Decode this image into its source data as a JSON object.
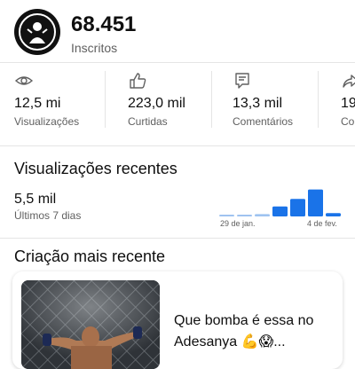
{
  "header": {
    "subscriber_count": "68.451",
    "subscriber_label": "Inscritos"
  },
  "stats": [
    {
      "icon": "eye-icon",
      "value": "12,5 mi",
      "label": "Visualizações"
    },
    {
      "icon": "thumbs-up-icon",
      "value": "223,0 mil",
      "label": "Curtidas"
    },
    {
      "icon": "comment-icon",
      "value": "13,3 mil",
      "label": "Comentários"
    },
    {
      "icon": "share-icon",
      "value": "19",
      "label": "Co"
    }
  ],
  "recent_views": {
    "title": "Visualizações recentes",
    "value": "5,5 mil",
    "period": "Últimos 7 dias",
    "chart_start_label": "29 de jan.",
    "chart_end_label": "4 de fev."
  },
  "chart_data": {
    "type": "bar",
    "categories": [
      "29 de jan.",
      "",
      "",
      "",
      "",
      "4 de fev.",
      ""
    ],
    "values": [
      0.06,
      0.06,
      0.08,
      0.35,
      0.62,
      0.95,
      0.12
    ],
    "value_unit": "fraction of chart height",
    "colors": {
      "low": "#9fc3f0",
      "high": "#1a73e8"
    },
    "title": "",
    "xlabel": "",
    "ylabel": ""
  },
  "recent_creation": {
    "title": "Criação mais recente",
    "video_title": "Que bomba é essa no Adesanya 💪😱..."
  },
  "colors": {
    "accent": "#1a73e8",
    "text_primary": "#0f0f0f",
    "text_secondary": "#606060"
  }
}
